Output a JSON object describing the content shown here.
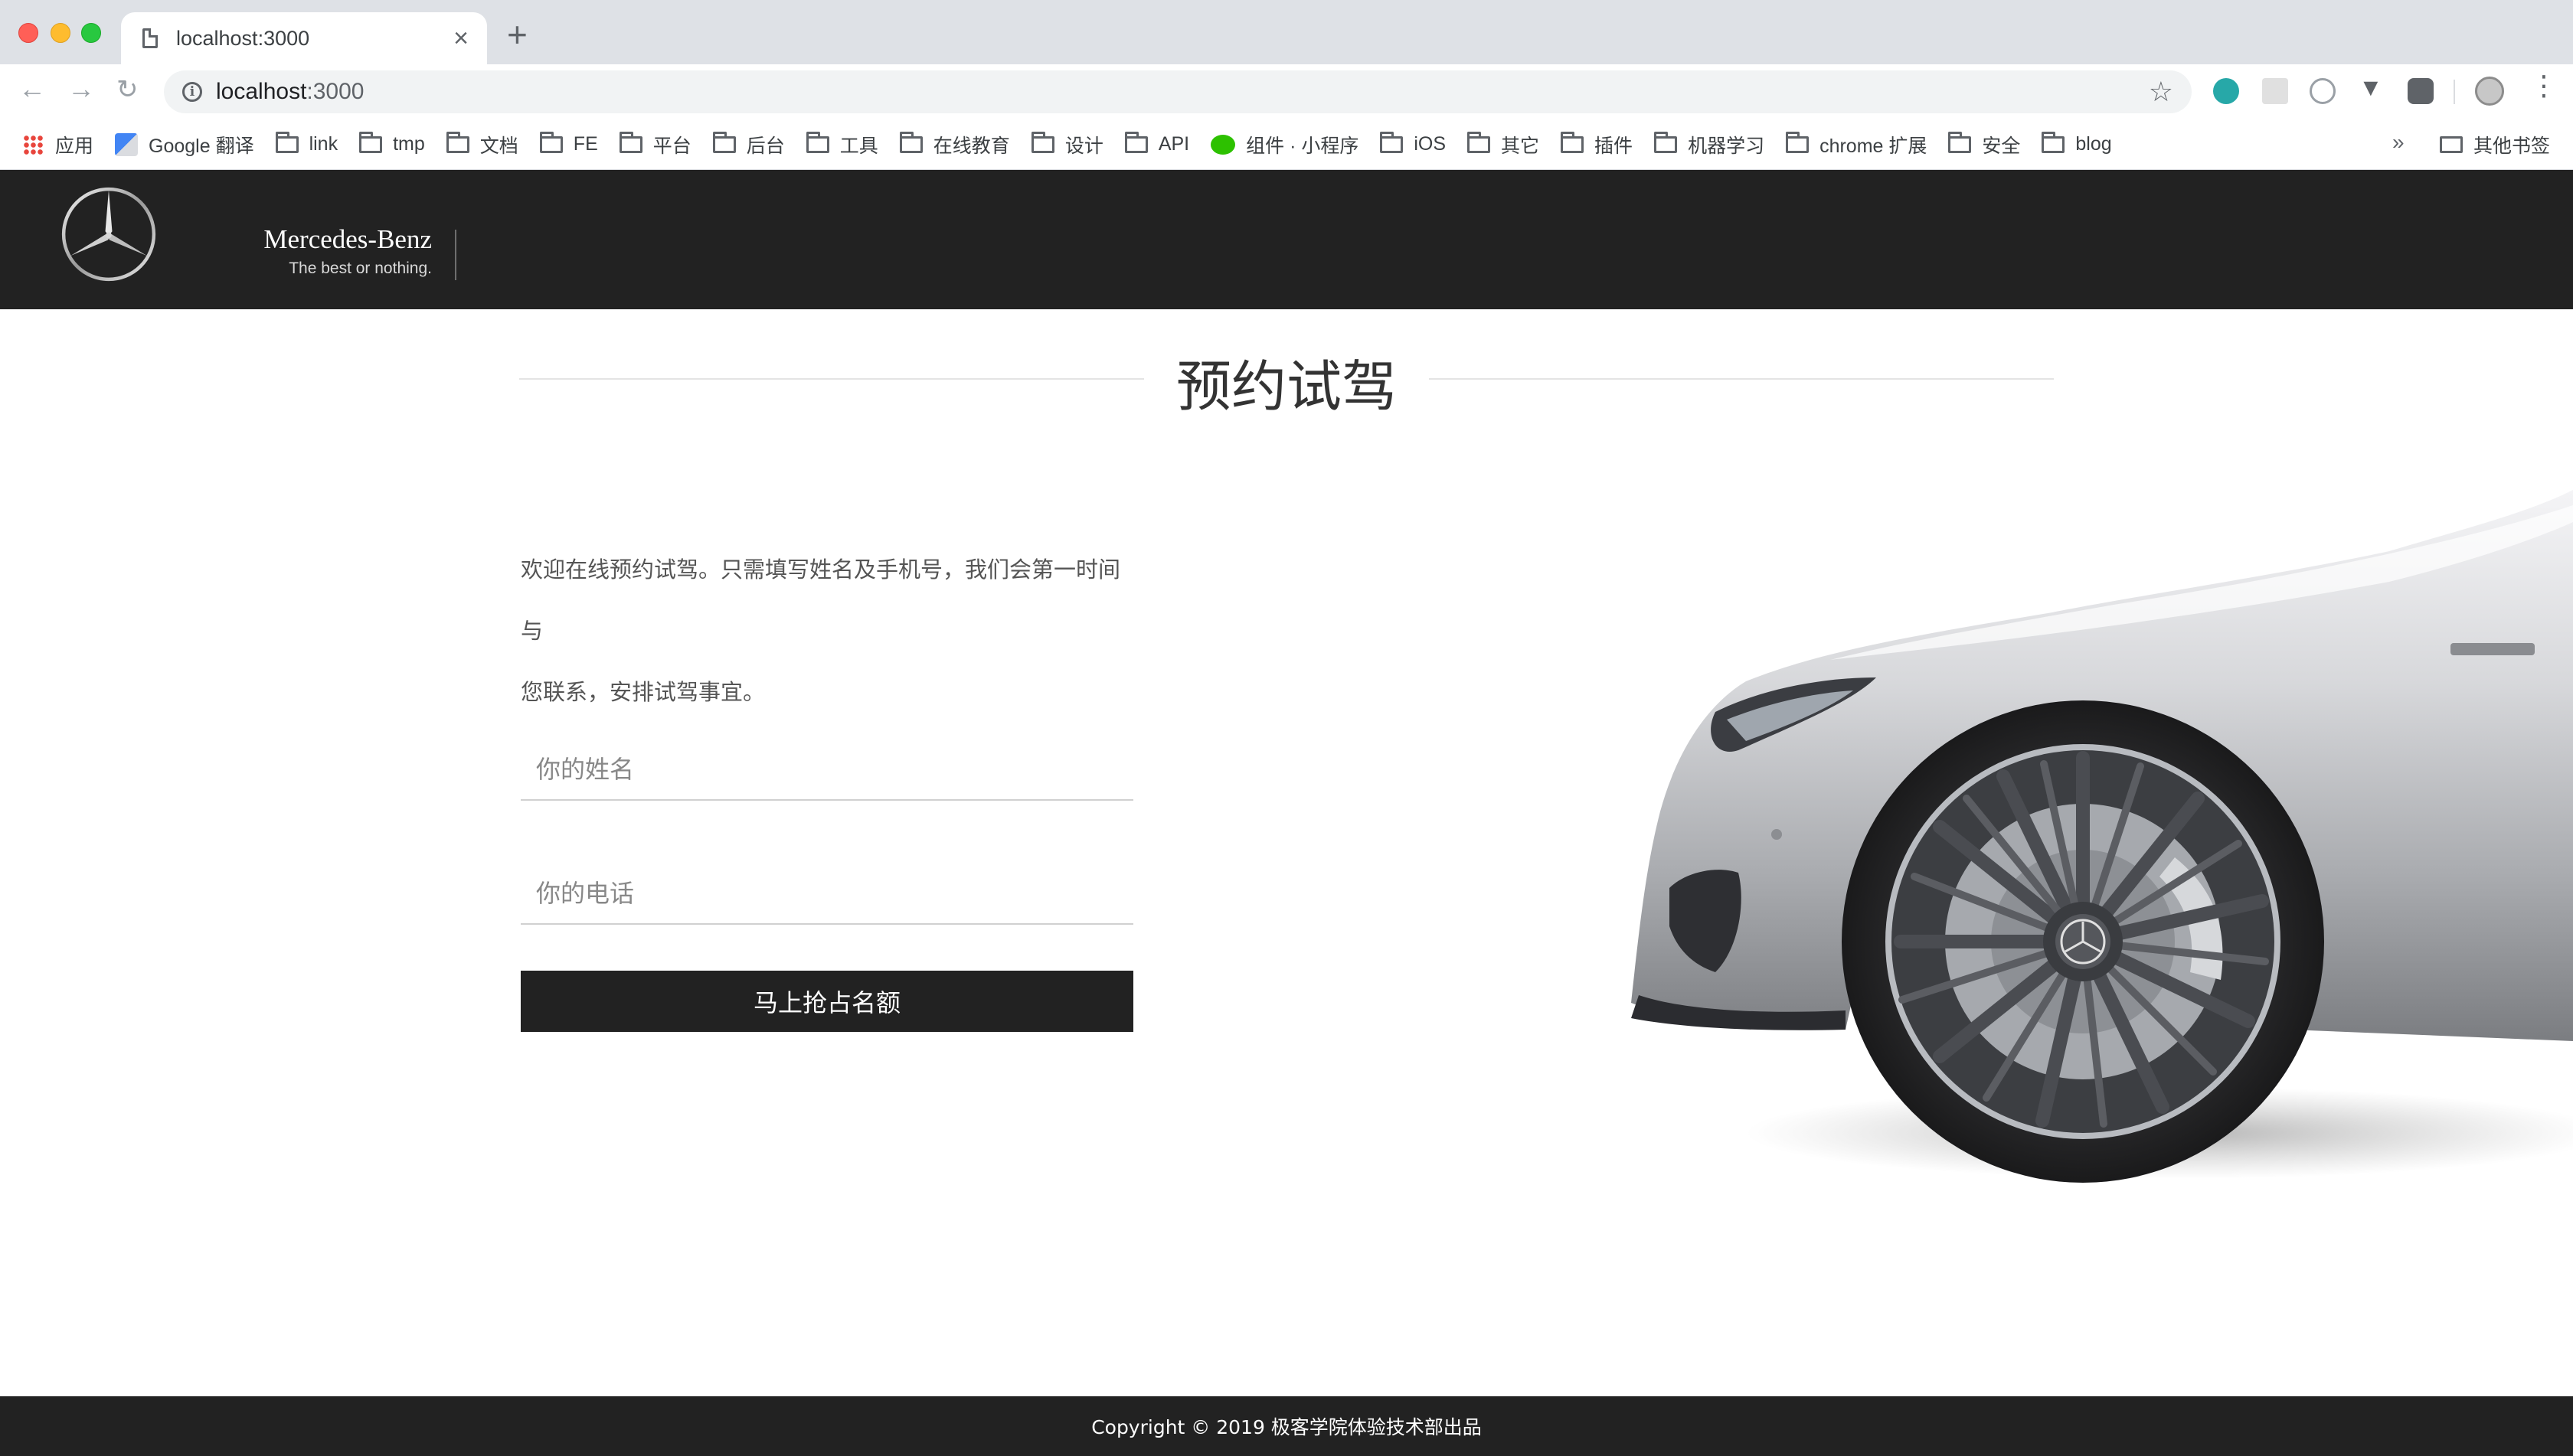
{
  "browser": {
    "tab_title": "localhost:3000",
    "tab_close": "×",
    "new_tab": "+",
    "back": "←",
    "forward": "→",
    "reload": "↻",
    "url_host": "localhost",
    "url_port": ":3000",
    "star": "☆",
    "menu": "⋮"
  },
  "bookmarks": {
    "items": [
      {
        "label": "应用",
        "icon": "apps-icon"
      },
      {
        "label": "Google 翻译",
        "icon": "google-translate-icon"
      },
      {
        "label": "link",
        "icon": "folder-icon"
      },
      {
        "label": "tmp",
        "icon": "folder-icon"
      },
      {
        "label": "文档",
        "icon": "folder-icon"
      },
      {
        "label": "FE",
        "icon": "folder-icon"
      },
      {
        "label": "平台",
        "icon": "folder-icon"
      },
      {
        "label": "后台",
        "icon": "folder-icon"
      },
      {
        "label": "工具",
        "icon": "folder-icon"
      },
      {
        "label": "在线教育",
        "icon": "folder-icon"
      },
      {
        "label": "设计",
        "icon": "folder-icon"
      },
      {
        "label": "API",
        "icon": "folder-icon"
      },
      {
        "label": "组件 · 小程序",
        "icon": "wechat-icon"
      },
      {
        "label": "iOS",
        "icon": "folder-icon"
      },
      {
        "label": "其它",
        "icon": "folder-icon"
      },
      {
        "label": "插件",
        "icon": "folder-icon"
      },
      {
        "label": "机器学习",
        "icon": "folder-icon"
      },
      {
        "label": "chrome 扩展",
        "icon": "folder-icon"
      },
      {
        "label": "安全",
        "icon": "folder-icon"
      },
      {
        "label": "blog",
        "icon": "folder-icon"
      }
    ],
    "more": "»",
    "other": "其他书签"
  },
  "header": {
    "brand_name": "Mercedes-Benz",
    "tagline": "The best or nothing."
  },
  "main": {
    "title": "预约试驾",
    "intro_line1": "欢迎在线预约试驾。只需填写姓名及手机号，我们会第一时间与",
    "intro_line2": "您联系，安排试驾事宜。",
    "name_placeholder": "你的姓名",
    "phone_placeholder": "你的电话",
    "submit_label": "马上抢占名额"
  },
  "footer": {
    "copyright": "Copyright © 2019 极客学院体验技术部出品"
  },
  "colors": {
    "header_bg": "#222222",
    "button_bg": "#222222",
    "footer_bg": "#222222",
    "text": "#333333"
  }
}
